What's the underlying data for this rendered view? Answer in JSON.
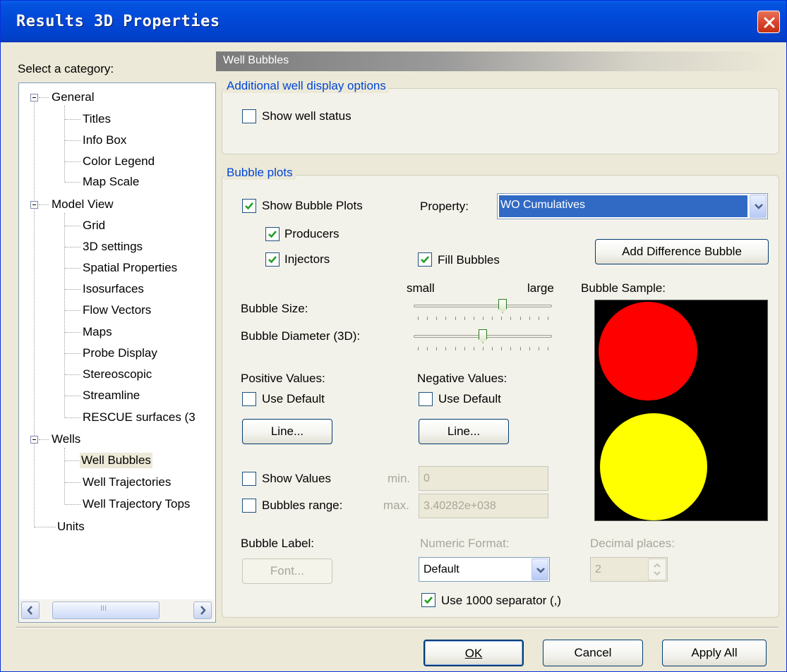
{
  "window": {
    "title": "Results 3D Properties"
  },
  "category_label": "Select a category:",
  "tree": {
    "general": "General",
    "general_items": [
      "Titles",
      "Info Box",
      "Color Legend",
      "Map Scale"
    ],
    "model_view": "Model View",
    "model_view_items": [
      "Grid",
      "3D settings",
      "Spatial Properties",
      "Isosurfaces",
      "Flow Vectors",
      "Maps",
      "Probe Display",
      "Stereoscopic",
      "Streamline",
      "RESCUE surfaces (3"
    ],
    "wells": "Wells",
    "wells_items": [
      "Well Bubbles",
      "Well Trajectories",
      "Well Trajectory Tops"
    ],
    "units": "Units",
    "scroll_grip": "III"
  },
  "section_title": "Well Bubbles",
  "well_display": {
    "legend": "Additional well display options",
    "show_well_status": "Show well status"
  },
  "bubble_plots": {
    "legend": "Bubble plots",
    "show_bubble_plots": "Show Bubble Plots",
    "property_label": "Property:",
    "property_value": "WO Cumulatives",
    "producers": "Producers",
    "injectors": "Injectors",
    "fill_bubbles": "Fill Bubbles",
    "add_difference_bubble": "Add Difference Bubble",
    "small": "small",
    "large": "large",
    "bubble_size": "Bubble Size:",
    "bubble_diameter": "Bubble Diameter (3D):",
    "bubble_size_level": 0.65,
    "bubble_diameter_level": 0.5,
    "bubble_sample": "Bubble Sample:",
    "positive_values": "Positive Values:",
    "negative_values": "Negative Values:",
    "use_default": "Use Default",
    "line_button": "Line...",
    "show_values": "Show Values",
    "bubbles_range": "Bubbles range:",
    "min_label": "min.",
    "max_label": "max.",
    "min_value": "0",
    "max_value": "3.40282e+038",
    "bubble_label": "Bubble Label:",
    "font_button": "Font...",
    "numeric_format_label": "Numeric Format:",
    "numeric_format_value": "Default",
    "decimal_places_label": "Decimal places:",
    "decimal_places_value": "2",
    "use_separator": "Use 1000 separator (,)"
  },
  "colors": {
    "positive_bubble": "#ff0000",
    "negative_bubble": "#ffff00"
  },
  "buttons": {
    "ok": "OK",
    "cancel": "Cancel",
    "apply_all": "Apply All"
  }
}
